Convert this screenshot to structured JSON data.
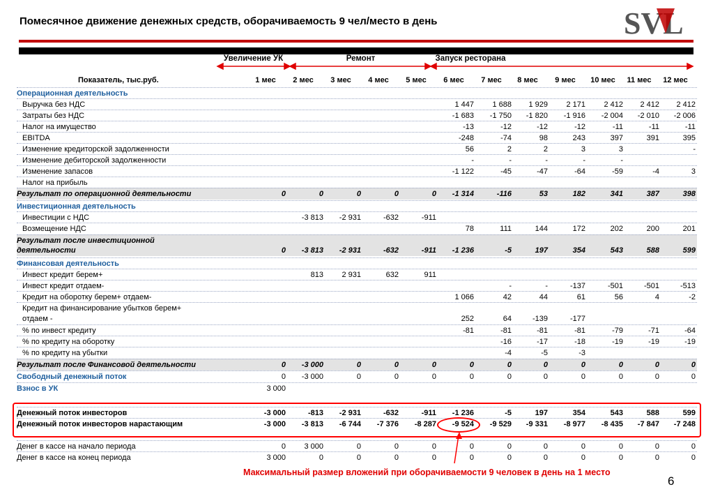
{
  "title": "Помесячное движение денежных средств, оборачиваемость 9 чел/место в день",
  "logo": {
    "text": "SVL"
  },
  "phases": [
    {
      "label": "Увеличение УК"
    },
    {
      "label": "Ремонт"
    },
    {
      "label": "Запуск ресторана"
    }
  ],
  "header": {
    "indicator": "Показатель, тыс.руб.",
    "months": [
      "1 мес",
      "2 мес",
      "3 мес",
      "4 мес",
      "5 мес",
      "6 мес",
      "7 мес",
      "8 мес",
      "9 мес",
      "10 мес",
      "11 мес",
      "12 мес"
    ]
  },
  "rows": [
    {
      "label": "Операционная деятельность",
      "type": "section",
      "values": [
        "",
        "",
        "",
        "",
        "",
        "",
        "",
        "",
        "",
        "",
        "",
        ""
      ]
    },
    {
      "label": "Выручка без НДС",
      "type": "item",
      "values": [
        "",
        "",
        "",
        "",
        "",
        "1 447",
        "1 688",
        "1 929",
        "2 171",
        "2 412",
        "2 412",
        "2 412"
      ]
    },
    {
      "label": "Затраты без НДС",
      "type": "item",
      "values": [
        "",
        "",
        "",
        "",
        "",
        "-1 683",
        "-1 750",
        "-1 820",
        "-1 916",
        "-2 004",
        "-2 010",
        "-2 006"
      ]
    },
    {
      "label": "Налог на имущество",
      "type": "item",
      "values": [
        "",
        "",
        "",
        "",
        "",
        "-13",
        "-12",
        "-12",
        "-12",
        "-11",
        "-11",
        "-11"
      ]
    },
    {
      "label": "EBITDA",
      "type": "item",
      "values": [
        "",
        "",
        "",
        "",
        "",
        "-248",
        "-74",
        "98",
        "243",
        "397",
        "391",
        "395"
      ]
    },
    {
      "label": "Изменение кредиторской задолженности",
      "type": "item",
      "values": [
        "",
        "",
        "",
        "",
        "",
        "56",
        "2",
        "2",
        "3",
        "3",
        "",
        "-"
      ]
    },
    {
      "label": "Изменение дебиторской задолженности",
      "type": "item",
      "values": [
        "",
        "",
        "",
        "",
        "",
        "-",
        "-",
        "-",
        "-",
        "-",
        "",
        ""
      ]
    },
    {
      "label": "Изменение запасов",
      "type": "item",
      "values": [
        "",
        "",
        "",
        "",
        "",
        "-1 122",
        "-45",
        "-47",
        "-64",
        "-59",
        "-4",
        "3"
      ]
    },
    {
      "label": "Налог на прибыль",
      "type": "item",
      "values": [
        "",
        "",
        "",
        "",
        "",
        "",
        "",
        "",
        "",
        "",
        "",
        ""
      ]
    },
    {
      "label": "Результат по операционной деятельности",
      "type": "result",
      "values": [
        "0",
        "0",
        "0",
        "0",
        "0",
        "-1 314",
        "-116",
        "53",
        "182",
        "341",
        "387",
        "398"
      ]
    },
    {
      "label": "Инвестиционная деятельность",
      "type": "section",
      "values": [
        "",
        "",
        "",
        "",
        "",
        "",
        "",
        "",
        "",
        "",
        "",
        ""
      ]
    },
    {
      "label": "Инвестиции с НДС",
      "type": "item",
      "values": [
        "",
        "-3 813",
        "-2 931",
        "-632",
        "-911",
        "",
        "",
        "",
        "",
        "",
        "",
        ""
      ]
    },
    {
      "label": "Возмещение НДС",
      "type": "item",
      "values": [
        "",
        "",
        "",
        "",
        "",
        "78",
        "111",
        "144",
        "172",
        "202",
        "200",
        "201"
      ]
    },
    {
      "label": "Результат после инвестиционной",
      "type": "result-top",
      "values": [
        "",
        "",
        "",
        "",
        "",
        "",
        "",
        "",
        "",
        "",
        "",
        ""
      ]
    },
    {
      "label": "деятельности",
      "type": "result-bottom",
      "values": [
        "0",
        "-3 813",
        "-2 931",
        "-632",
        "-911",
        "-1 236",
        "-5",
        "197",
        "354",
        "543",
        "588",
        "599"
      ]
    },
    {
      "label": "Финансовая деятельность",
      "type": "section",
      "values": [
        "",
        "",
        "",
        "",
        "",
        "",
        "",
        "",
        "",
        "",
        "",
        ""
      ]
    },
    {
      "label": "Инвест кредит берем+",
      "type": "item",
      "values": [
        "",
        "813",
        "2 931",
        "632",
        "911",
        "",
        "",
        "",
        "",
        "",
        "",
        ""
      ]
    },
    {
      "label": "Инвест кредит отдаем-",
      "type": "item",
      "values": [
        "",
        "",
        "",
        "",
        "",
        "",
        "-",
        "-",
        "-137",
        "-501",
        "-501",
        "-513"
      ]
    },
    {
      "label": "Кредит на оборотку берем+ отдаем-",
      "type": "item",
      "values": [
        "",
        "",
        "",
        "",
        "",
        "1 066",
        "42",
        "44",
        "61",
        "56",
        "4",
        "-2"
      ]
    },
    {
      "label": "Кредит на финансирование убытков берем+",
      "type": "item",
      "values": [
        "",
        "",
        "",
        "",
        "",
        "",
        "",
        "",
        "",
        "",
        "",
        ""
      ]
    },
    {
      "label": "отдаем -",
      "type": "item-cont",
      "values": [
        "",
        "",
        "",
        "",
        "",
        "252",
        "64",
        "-139",
        "-177",
        "",
        "",
        ""
      ]
    },
    {
      "label": "% по инвест кредиту",
      "type": "item",
      "values": [
        "",
        "",
        "",
        "",
        "",
        "-81",
        "-81",
        "-81",
        "-81",
        "-79",
        "-71",
        "-64"
      ]
    },
    {
      "label": "% по кредиту на оборотку",
      "type": "item",
      "values": [
        "",
        "",
        "",
        "",
        "",
        "",
        "-16",
        "-17",
        "-18",
        "-19",
        "-19",
        "-19"
      ]
    },
    {
      "label": "% по кредиту на убытки",
      "type": "item",
      "values": [
        "",
        "",
        "",
        "",
        "",
        "",
        "-4",
        "-5",
        "-3",
        "",
        "",
        ""
      ]
    },
    {
      "label": "Результат после Финансовой деятельности",
      "type": "result",
      "values": [
        "0",
        "-3 000",
        "0",
        "0",
        "0",
        "0",
        "0",
        "0",
        "0",
        "0",
        "0",
        "0"
      ]
    },
    {
      "label": "Свободный денежный поток",
      "type": "section",
      "values": [
        "0",
        "-3 000",
        "0",
        "0",
        "0",
        "0",
        "0",
        "0",
        "0",
        "0",
        "0",
        "0"
      ]
    },
    {
      "label": "Взнос в УК",
      "type": "section",
      "values": [
        "3 000",
        "",
        "",
        "",
        "",
        "",
        "",
        "",
        "",
        "",
        "",
        ""
      ]
    },
    {
      "label": "Денежный поток инвесторов",
      "type": "bold",
      "values": [
        "-3 000",
        "-813",
        "-2 931",
        "-632",
        "-911",
        "-1 236",
        "-5",
        "197",
        "354",
        "543",
        "588",
        "599"
      ]
    },
    {
      "label": "Денежный поток инвесторов нарастающим",
      "type": "bold",
      "values": [
        "-3 000",
        "-3 813",
        "-6 744",
        "-7 376",
        "-8 287",
        "-9 524",
        "-9 529",
        "-9 331",
        "-8 977",
        "-8 435",
        "-7 847",
        "-7 248"
      ]
    },
    {
      "label": "Денег в кассе на начало периода",
      "type": "plain",
      "values": [
        "0",
        "3 000",
        "0",
        "0",
        "0",
        "0",
        "0",
        "0",
        "0",
        "0",
        "0",
        "0"
      ]
    },
    {
      "label": "Денег в кассе на конец периода",
      "type": "plain",
      "values": [
        "3 000",
        "0",
        "0",
        "0",
        "0",
        "0",
        "0",
        "0",
        "0",
        "0",
        "0",
        "0"
      ]
    }
  ],
  "footnote": "Максимальный размер вложений при оборачиваемости 9 человек в день на 1 место",
  "page_number": "6",
  "colors": {
    "accent_red": "#c00000",
    "section_blue": "#1f5f9e",
    "highlight_red": "#ff0000"
  }
}
